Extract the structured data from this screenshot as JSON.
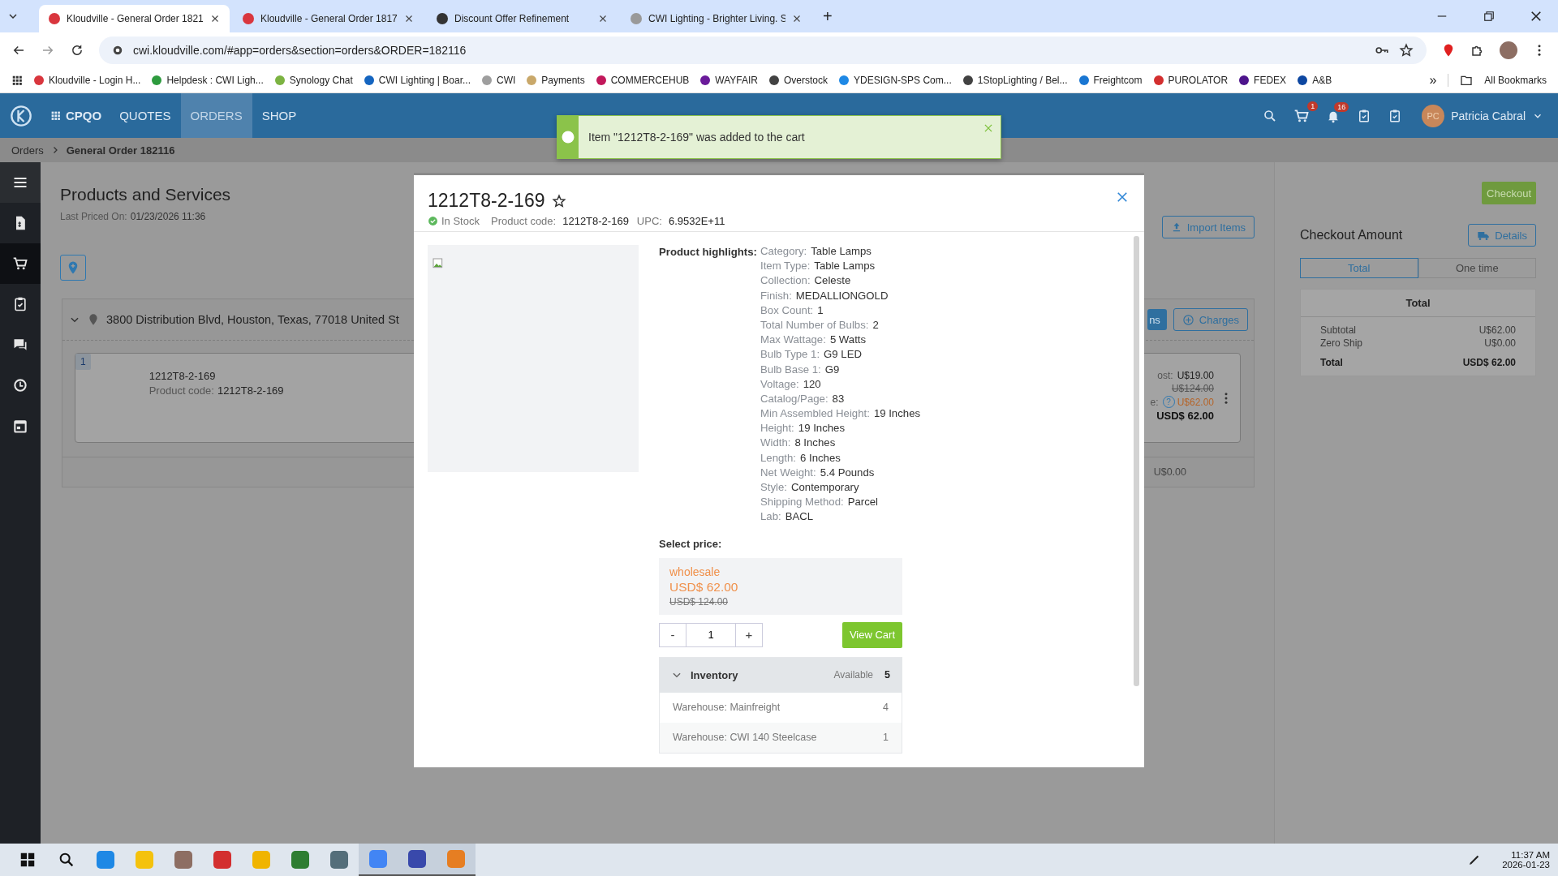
{
  "browser": {
    "tabs": [
      {
        "title": "Kloudville - General Order 1821",
        "selected": true,
        "color": "#d9363e"
      },
      {
        "title": "Kloudville - General Order 1817",
        "selected": false,
        "color": "#d9363e"
      },
      {
        "title": "Discount Offer Refinement",
        "selected": false,
        "color": "#333333"
      },
      {
        "title": "CWI Lighting - Brighter Living. S",
        "selected": false,
        "color": "#999999"
      }
    ],
    "new_tab": "+",
    "url": "cwi.kloudville.com/#app=orders&section=orders&ORDER=182116",
    "bookmarks": [
      {
        "label": "Kloudville - Login H...",
        "color": "#d9363e"
      },
      {
        "label": "Helpdesk : CWI Ligh...",
        "color": "#2e9b3e"
      },
      {
        "label": "Synology Chat",
        "color": "#7cb342"
      },
      {
        "label": "CWI Lighting | Boar...",
        "color": "#1565c0"
      },
      {
        "label": "CWI",
        "color": "#9e9e9e"
      },
      {
        "label": "Payments",
        "color": "#c9a86a"
      },
      {
        "label": "COMMERCEHUB",
        "color": "#c2185b"
      },
      {
        "label": "WAYFAIR",
        "color": "#6a1b9a"
      },
      {
        "label": "Overstock",
        "color": "#424242"
      },
      {
        "label": "YDESIGN-SPS Com...",
        "color": "#1e88e5"
      },
      {
        "label": "1StopLighting / Bel...",
        "color": "#424242"
      },
      {
        "label": "Freightcom",
        "color": "#1976d2"
      },
      {
        "label": "PUROLATOR",
        "color": "#d32f2f"
      },
      {
        "label": "FEDEX",
        "color": "#4d148c"
      },
      {
        "label": "A&B",
        "color": "#0d47a1"
      }
    ],
    "more": "»",
    "all_bookmarks": "All Bookmarks"
  },
  "app_header": {
    "brand": "CPQO",
    "nav": [
      {
        "label": "QUOTES",
        "selected": false
      },
      {
        "label": "ORDERS",
        "selected": true
      },
      {
        "label": "SHOP",
        "selected": false
      }
    ],
    "cart_badge": "1",
    "notification_badge": "16",
    "user_initials": "PC",
    "user_name": "Patricia Cabral"
  },
  "toast": {
    "message": "Item \"1212T8-2-169\" was added to the cart"
  },
  "breadcrumb": [
    "Orders",
    "General Order 182116"
  ],
  "sidebar": {
    "items": [
      {
        "kind": "invoice",
        "selected": false
      },
      {
        "kind": "cart",
        "selected": true
      },
      {
        "kind": "clipboard",
        "selected": false
      },
      {
        "kind": "chat",
        "selected": false
      },
      {
        "kind": "history",
        "selected": false
      },
      {
        "kind": "calendar",
        "selected": false
      }
    ]
  },
  "page": {
    "title": "Products and Services",
    "last_priced_label": "Last Priced On:",
    "last_priced_value": "01/23/2026 11:36",
    "import_button": "Import Items",
    "shipment": {
      "address": "3800 Distribution Blvd, Houston, Texas, 77018 United St",
      "add_button": "ns",
      "charges_button": "Charges",
      "footer_amount": "U$0.00",
      "item": {
        "number": "1",
        "name": "1212T8-2-169",
        "code_label": "Product code:",
        "code_value": "1212T8-2-169",
        "cost_label": "ost:",
        "cost": "U$19.00",
        "list_price": "U$124.00",
        "price_label": "e:",
        "help": "?",
        "price": "U$62.00",
        "total": "USD$ 62.00"
      }
    }
  },
  "checkout": {
    "button": "Checkout",
    "title": "Checkout Amount",
    "details_button": "Details",
    "tabs": [
      {
        "label": "Total",
        "selected": true
      },
      {
        "label": "One time",
        "selected": false
      }
    ],
    "summary": {
      "title": "Total",
      "rows": [
        {
          "label": "Subtotal",
          "value": "U$62.00",
          "bold": false
        },
        {
          "label": "Zero Ship",
          "value": "U$0.00",
          "bold": false
        },
        {
          "label": "Total",
          "value": "USD$ 62.00",
          "bold": true
        }
      ]
    }
  },
  "modal": {
    "title": "1212T8-2-169",
    "stock": "In Stock",
    "code_label": "Product code:",
    "code_value": "1212T8-2-169",
    "upc_label": "UPC:",
    "upc_value": "6.9532E+11",
    "highlights_label": "Product highlights:",
    "specs": [
      {
        "label": "Category:",
        "value": "Table Lamps"
      },
      {
        "label": "Item Type:",
        "value": "Table Lamps"
      },
      {
        "label": "Collection:",
        "value": "Celeste"
      },
      {
        "label": "Finish:",
        "value": "MEDALLIONGOLD"
      },
      {
        "label": "Box Count:",
        "value": "1"
      },
      {
        "label": "Total Number of Bulbs:",
        "value": "2"
      },
      {
        "label": "Max Wattage:",
        "value": "5 Watts"
      },
      {
        "label": "Bulb Type 1:",
        "value": "G9 LED"
      },
      {
        "label": "Bulb Base 1:",
        "value": "G9"
      },
      {
        "label": "Voltage:",
        "value": "120"
      },
      {
        "label": "Catalog/Page:",
        "value": "83"
      },
      {
        "label": "Min Assembled Height:",
        "value": "19 Inches"
      },
      {
        "label": "Height:",
        "value": "19 Inches"
      },
      {
        "label": "Width:",
        "value": "8 Inches"
      },
      {
        "label": "Length:",
        "value": "6 Inches"
      },
      {
        "label": "Net Weight:",
        "value": "5.4 Pounds"
      },
      {
        "label": "Style:",
        "value": "Contemporary"
      },
      {
        "label": "Shipping Method:",
        "value": "Parcel"
      },
      {
        "label": "Lab:",
        "value": "BACL"
      }
    ],
    "select_price_label": "Select price:",
    "prices": [
      {
        "name": "wholesale",
        "price": "USD$ 62.00",
        "old_price": "USD$ 124.00",
        "selected": true
      }
    ],
    "minus": "-",
    "quantity": "1",
    "plus": "+",
    "view_cart": "View Cart",
    "inventory": {
      "title": "Inventory",
      "expanded": true,
      "available_label": "Available",
      "available": "5",
      "rows": [
        {
          "warehouse": "Warehouse: Mainfreight",
          "qty": "4"
        },
        {
          "warehouse": "Warehouse: CWI 140 Steelcase",
          "qty": "1"
        }
      ]
    }
  },
  "taskbar": {
    "apps": [
      {
        "color": "#1e88e5",
        "active": false
      },
      {
        "color": "#f4c20d",
        "active": false
      },
      {
        "color": "#8d6e63",
        "active": false
      },
      {
        "color": "#d32f2f",
        "active": false
      },
      {
        "color": "#f0b400",
        "active": false
      },
      {
        "color": "#2e7d32",
        "active": false
      },
      {
        "color": "#546e7a",
        "active": false
      },
      {
        "color": "#4285f4",
        "active": true
      },
      {
        "color": "#3949ab",
        "active": true
      },
      {
        "color": "#e67e22",
        "active": true
      }
    ],
    "time": "11:37 AM",
    "date": "2026-01-23"
  }
}
